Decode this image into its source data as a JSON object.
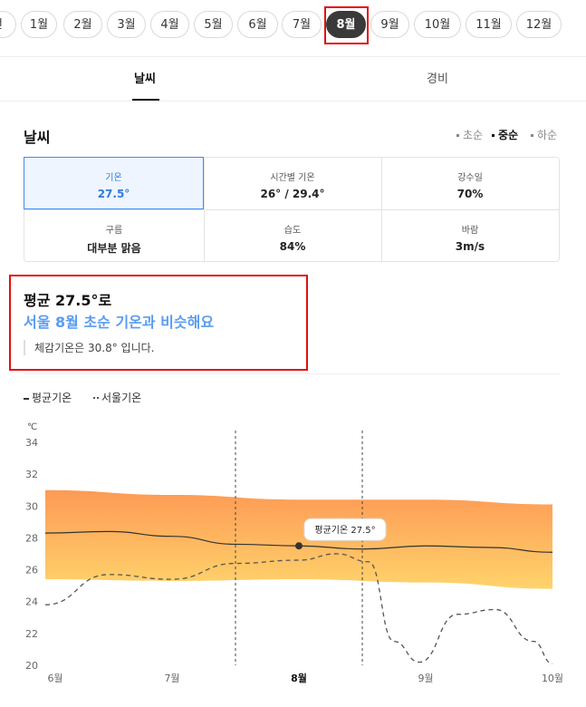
{
  "months": {
    "items": [
      "전",
      "1월",
      "2월",
      "3월",
      "4월",
      "5월",
      "6월",
      "7월",
      "8월",
      "9월",
      "10월",
      "11월",
      "12월"
    ],
    "selected": "8월"
  },
  "tabs": [
    {
      "label": "날씨",
      "active": true
    },
    {
      "label": "경비",
      "active": false
    }
  ],
  "weather": {
    "title": "날씨",
    "periods": [
      {
        "label": "초순",
        "active": false
      },
      {
        "label": "중순",
        "active": true
      },
      {
        "label": "하순",
        "active": false
      }
    ],
    "cells": [
      {
        "label": "기온",
        "value": "27.5°"
      },
      {
        "label": "시간별 기온",
        "value": "26° / 29.4°"
      },
      {
        "label": "강수일",
        "value": "70%"
      },
      {
        "label": "구름",
        "value": "대부분 맑음"
      },
      {
        "label": "습도",
        "value": "84%"
      },
      {
        "label": "바람",
        "value": "3m/s"
      }
    ]
  },
  "summary": {
    "line1": "평균 27.5°로",
    "line2": "서울 8월 초순 기온과 비슷해요",
    "line3": "체감기온은 30.8° 입니다."
  },
  "legend": {
    "avg": "평균기온",
    "seoul": "서울기온"
  },
  "chart_data": {
    "type": "line",
    "unit": "℃",
    "ylim": [
      20,
      34
    ],
    "y_ticks": [
      "34",
      "32",
      "30",
      "28",
      "26",
      "24",
      "22",
      "20"
    ],
    "x_ticks": [
      "6월",
      "7월",
      "8월",
      "9월",
      "10월"
    ],
    "tooltip": "평균기온 27.5°",
    "colors": {
      "band_top": "#fd9a55",
      "band_bottom": "#ffd36b",
      "avg_line": "#333333",
      "seoul_line": "#555555"
    },
    "series": [
      {
        "name": "평균기온",
        "points": [
          [
            0,
            28.3
          ],
          [
            0.5,
            28.4
          ],
          [
            1,
            28.1
          ],
          [
            1.5,
            27.6
          ],
          [
            2,
            27.5
          ],
          [
            2.5,
            27.3
          ],
          [
            3,
            27.5
          ],
          [
            3.5,
            27.4
          ],
          [
            4,
            27.1
          ]
        ]
      },
      {
        "name": "서울기온",
        "points": [
          [
            0,
            23.8
          ],
          [
            0.5,
            25.7
          ],
          [
            1,
            25.4
          ],
          [
            1.5,
            26.4
          ],
          [
            2,
            26.6
          ],
          [
            2.3,
            27.0
          ],
          [
            2.55,
            26.5
          ],
          [
            2.75,
            21.5
          ],
          [
            2.95,
            20.2
          ],
          [
            3.25,
            23.2
          ],
          [
            3.55,
            23.5
          ],
          [
            3.85,
            21.5
          ],
          [
            4,
            20.1
          ]
        ]
      },
      {
        "name": "band_high",
        "points": [
          [
            0,
            31.0
          ],
          [
            1,
            30.7
          ],
          [
            2,
            30.4
          ],
          [
            3,
            30.4
          ],
          [
            4,
            30.1
          ]
        ]
      },
      {
        "name": "band_low",
        "points": [
          [
            0,
            25.4
          ],
          [
            1,
            25.3
          ],
          [
            2,
            25.4
          ],
          [
            3,
            25.2
          ],
          [
            4,
            24.8
          ]
        ]
      }
    ],
    "marker_x": 2,
    "dashed_x": [
      1.5,
      2.5
    ]
  }
}
